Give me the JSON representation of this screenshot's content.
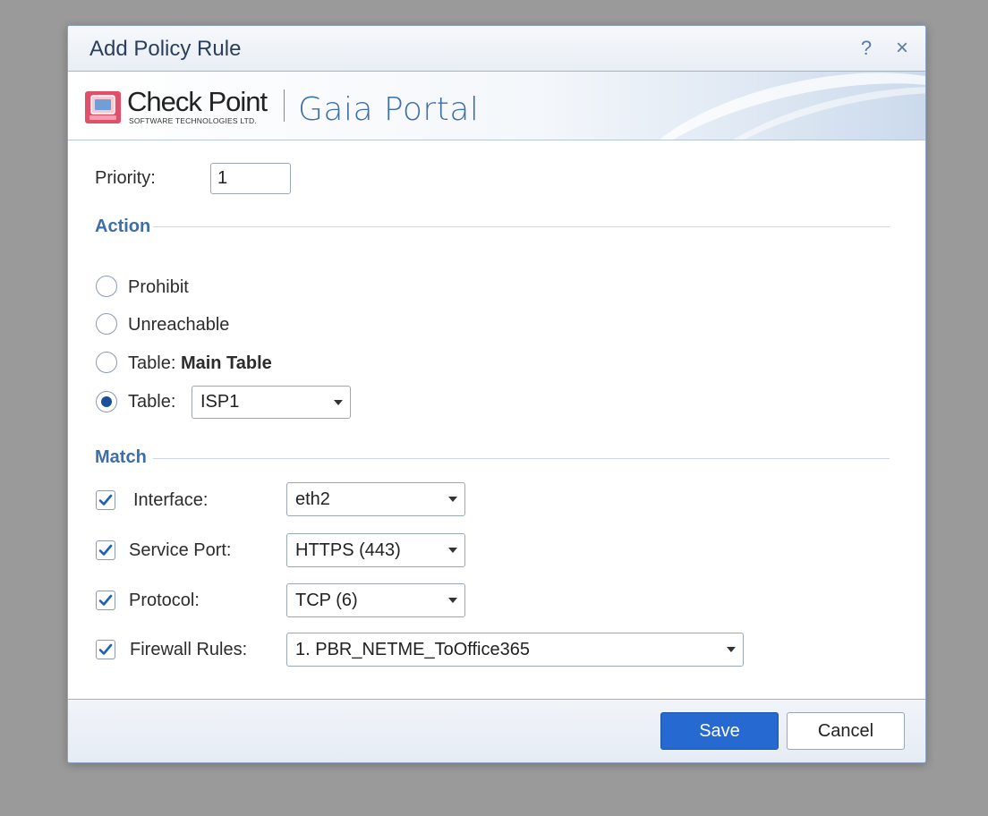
{
  "dialog": {
    "title": "Add Policy Rule",
    "help_glyph": "?",
    "close_glyph": "×"
  },
  "banner": {
    "brand_name": "Check Point",
    "brand_sub": "SOFTWARE TECHNOLOGIES LTD.",
    "product": "Gaia Portal"
  },
  "form": {
    "priority_label": "Priority:",
    "priority_value": "1",
    "action": {
      "header": "Action",
      "options": {
        "prohibit": "Prohibit",
        "unreachable": "Unreachable",
        "table_main_prefix": "Table:",
        "table_main_value": "Main Table",
        "table_custom_prefix": "Table:",
        "table_custom_value": "ISP1"
      },
      "selected": "table_custom"
    },
    "match": {
      "header": "Match",
      "interface_label": "Interface:",
      "interface_value": "eth2",
      "interface_checked": true,
      "service_label": "Service Port:",
      "service_value": "HTTPS (443)",
      "service_checked": true,
      "protocol_label": "Protocol:",
      "protocol_value": "TCP (6)",
      "protocol_checked": true,
      "firewall_label": "Firewall Rules:",
      "firewall_value": "1. PBR_NETME_ToOffice365",
      "firewall_checked": true
    }
  },
  "footer": {
    "save_label": "Save",
    "cancel_label": "Cancel"
  },
  "colors": {
    "accent": "#2669d1",
    "section_header": "#3e6ea8",
    "check_mark": "#1b5fc4"
  }
}
